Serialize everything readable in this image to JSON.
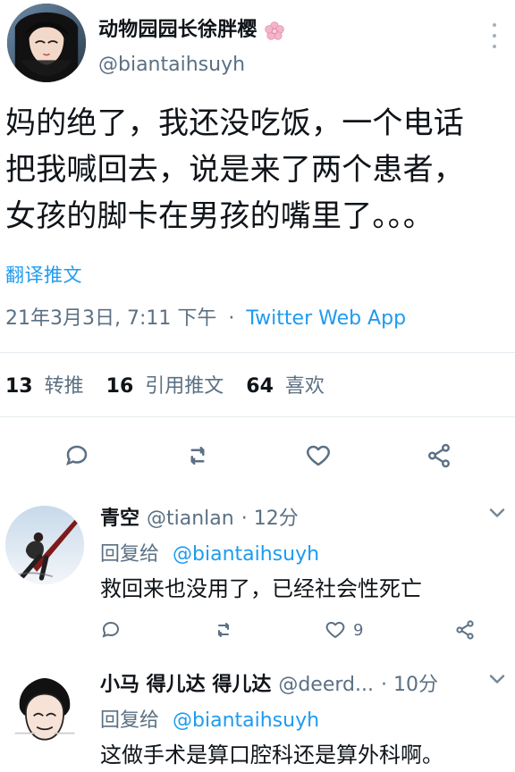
{
  "tweet": {
    "author": {
      "display_name": "动物园园长徐胖樱",
      "handle": "@biantaihsuyh"
    },
    "text": "妈的绝了，我还没吃饭，一个电话\n把我喊回去，说是来了两个患者，\n女孩的脚卡在男孩的嘴里了。。。",
    "translate_label": "翻译推文",
    "meta": {
      "date_time": "21年3月3日, 7:11 下午",
      "separator": "·",
      "source": "Twitter Web App"
    },
    "stats": {
      "retweets_count": "13",
      "retweets_label": "转推",
      "quotes_count": "16",
      "quotes_label": "引用推文",
      "likes_count": "64",
      "likes_label": "喜欢"
    }
  },
  "replies": [
    {
      "display_name": "青空",
      "handle": "@tianlan",
      "time": "· 12分",
      "reply_to_label": "回复给",
      "reply_to_handle": "@biantaihsuyh",
      "text": "救回来也没用了，已经社会性死亡",
      "likes_count": "9"
    },
    {
      "display_name": "小马 得儿达 得儿达",
      "handle": "@deerd...",
      "time": "· 10分",
      "reply_to_label": "回复给",
      "reply_to_handle": "@biantaihsuyh",
      "text": "这做手术是算口腔科还是算外科啊。"
    }
  ],
  "icons": {
    "reply": "reply-icon",
    "retweet": "retweet-icon",
    "like": "heart-icon",
    "share": "share-icon",
    "more": "kebab-icon",
    "chevron": "chevron-down-icon"
  },
  "colors": {
    "text": "#0f1419",
    "muted": "#5b7083",
    "link": "#1d9bf0",
    "divider": "#e6ecf0"
  }
}
